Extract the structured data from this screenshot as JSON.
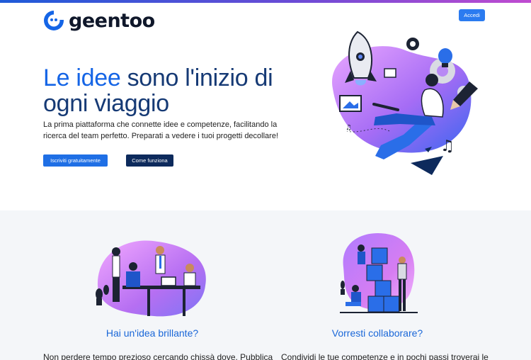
{
  "header": {
    "logo_text": "geentoo",
    "login_label": "Accedi"
  },
  "hero": {
    "title_accent": "Le idee",
    "title_rest": " sono l'inizio di ogni viaggio",
    "subtitle": "La prima piattaforma che connette idee e competenze, facilitando la ricerca del team perfetto. Preparati a vedere i tuoi progetti decollare!",
    "cta_primary": "Iscriviti gratuitamente",
    "cta_secondary": "Come funziona"
  },
  "features": [
    {
      "title": "Hai un'idea brillante?",
      "text": "Non perdere tempo prezioso cercando chissà dove. Pubblica"
    },
    {
      "title": "Vorresti collaborare?",
      "text": "Condividi le tue competenze e in pochi passi troverai le"
    }
  ],
  "colors": {
    "brand_blue": "#1565e6",
    "navy": "#163a75",
    "button_dark": "#0d2a5c",
    "section_bg": "#f4f6f9",
    "gradient_violet": "#c86bff"
  },
  "icons": [
    "geentoo-logo-icon",
    "rocket-icon",
    "gear-icon",
    "lightbulb-icon",
    "pencil-icon",
    "picture-icon",
    "music-note-icon",
    "paper-plane-icon"
  ]
}
